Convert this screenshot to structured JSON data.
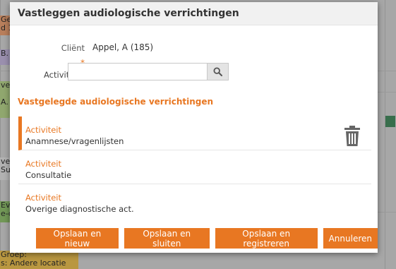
{
  "background": {
    "calendar_snippets": [
      "Gee",
      "d 1",
      "B.",
      "ver",
      "A.",
      "ver",
      "Sub",
      "Ev",
      "e-c",
      "Groep:",
      "s: Andere locatie"
    ]
  },
  "dialog": {
    "title": "Vastleggen audiologische verrichtingen",
    "client_label": "Cliënt",
    "client_value": "Appel, A (185)",
    "activity_label": "Activiteit",
    "required_marker": "*",
    "activity_input_value": "",
    "activity_input_placeholder": "",
    "section_title": "Vastgelegde audiologische verrichtingen",
    "items": [
      {
        "label": "Activiteit",
        "value": "Anamnese/vragenlijsten"
      },
      {
        "label": "Activiteit",
        "value": "Consultatie"
      },
      {
        "label": "Activiteit",
        "value": "Overige diagnostische act."
      }
    ],
    "buttons": {
      "save_new": "Opslaan en nieuw",
      "save_close": "Opslaan en sluiten",
      "save_register": "Opslaan en registreren",
      "cancel": "Annuleren"
    }
  },
  "colors": {
    "accent": "#e87722",
    "button": "#e87722"
  },
  "icons": {
    "search": "search-icon",
    "delete": "trash-icon"
  }
}
